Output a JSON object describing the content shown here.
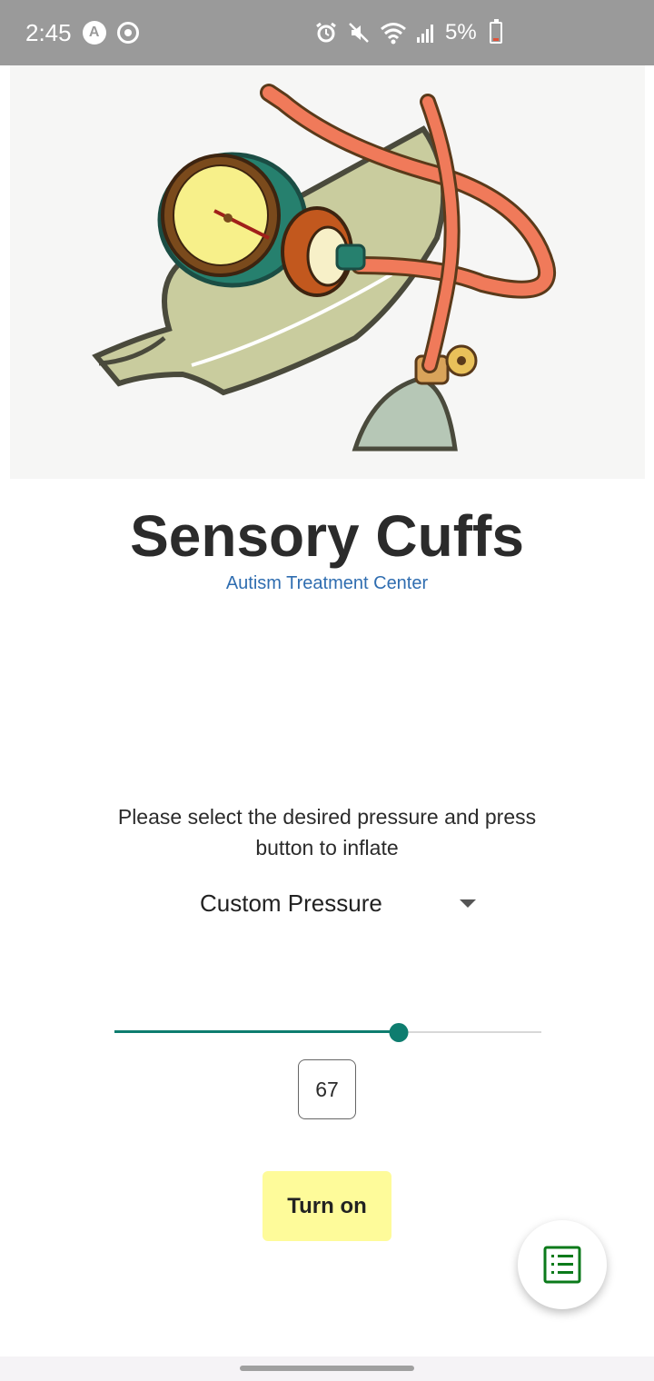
{
  "status_bar": {
    "time": "2:45",
    "battery": "5%"
  },
  "app": {
    "title": "Sensory Cuffs",
    "subtitle": "Autism Treatment Center"
  },
  "instructions": "Please select the desired pressure and press button to inflate",
  "pressure_select": {
    "selected": "Custom Pressure"
  },
  "slider": {
    "value": 67,
    "fraction": 0.665
  },
  "turn_on_label": "Turn on",
  "colors": {
    "accent": "#0e7d6f",
    "button": "#fefb9a",
    "subtitle": "#2f6db0",
    "fab_icon": "#0a7a1a"
  }
}
